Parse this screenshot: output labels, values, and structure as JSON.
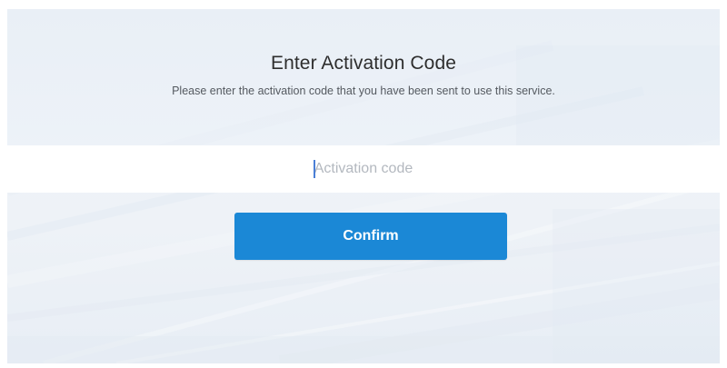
{
  "header": {
    "title": "Enter Activation Code",
    "subtitle": "Please enter the activation code that you have been sent to use this service."
  },
  "form": {
    "activation_value": "",
    "activation_placeholder": "Activation code",
    "confirm_label": "Confirm"
  },
  "colors": {
    "accent": "#1b88d6",
    "caret": "#4a7fd6",
    "background": "#ebf0f6"
  }
}
